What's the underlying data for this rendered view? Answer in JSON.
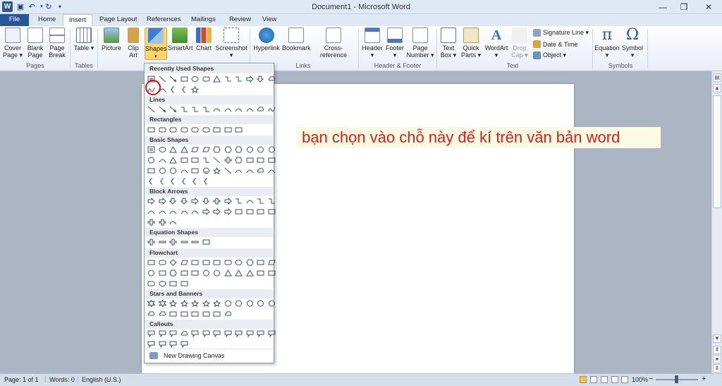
{
  "titlebar": {
    "title": "Document1 - Microsoft Word",
    "app_icon": "W",
    "min": "—",
    "max": "❐",
    "close": "✕"
  },
  "tabs": [
    "File",
    "Home",
    "Insert",
    "Page Layout",
    "References",
    "Mailings",
    "Review",
    "View"
  ],
  "ribbon": {
    "pages": {
      "cover": "Cover Page ▾",
      "blank": "Blank Page",
      "break": "Page Break",
      "group": "Pages"
    },
    "tables": {
      "table": "Table ▾",
      "group": "Tables"
    },
    "illustrations": {
      "picture": "Picture",
      "clipart": "Clip Art",
      "shapes": "Shapes",
      "smartart": "SmartArt",
      "chart": "Chart",
      "screenshot": "Screenshot ▾"
    },
    "links": {
      "hyperlink": "Hyperlink",
      "bookmark": "Bookmark",
      "crossref": "Cross-reference",
      "group": "Links"
    },
    "hf": {
      "header": "Header ▾",
      "footer": "Footer ▾",
      "pagenum": "Page Number ▾",
      "group": "Header & Footer"
    },
    "text": {
      "textbox": "Text Box ▾",
      "quickparts": "Quick Parts ▾",
      "wordart": "WordArt ▾",
      "dropcap": "Drop Cap ▾",
      "sigline": "Signature Line ▾",
      "datetime": "Date & Time",
      "object": "Object ▾",
      "group": "Text"
    },
    "symbols": {
      "equation": "Equation ▾",
      "symbol": "Symbol ▾",
      "group": "Symbols"
    }
  },
  "dropdown": {
    "sections": [
      "Recently Used Shapes",
      "Lines",
      "Rectangles",
      "Basic Shapes",
      "Block Arrows",
      "Equation Shapes",
      "Flowchart",
      "Stars and Banners",
      "Callouts"
    ],
    "new_canvas": "New Drawing Canvas"
  },
  "annotation": "bạn chọn vào chỗ này để kí trên văn bản word",
  "status": {
    "page": "Page: 1 of 1",
    "words": "Words: 0",
    "lang": "English (U.S.)",
    "zoom": "100%"
  },
  "colors": {
    "file_tab": "#2a5699",
    "annotation_text": "#e01b1b",
    "highlight": "#fcd66c"
  }
}
